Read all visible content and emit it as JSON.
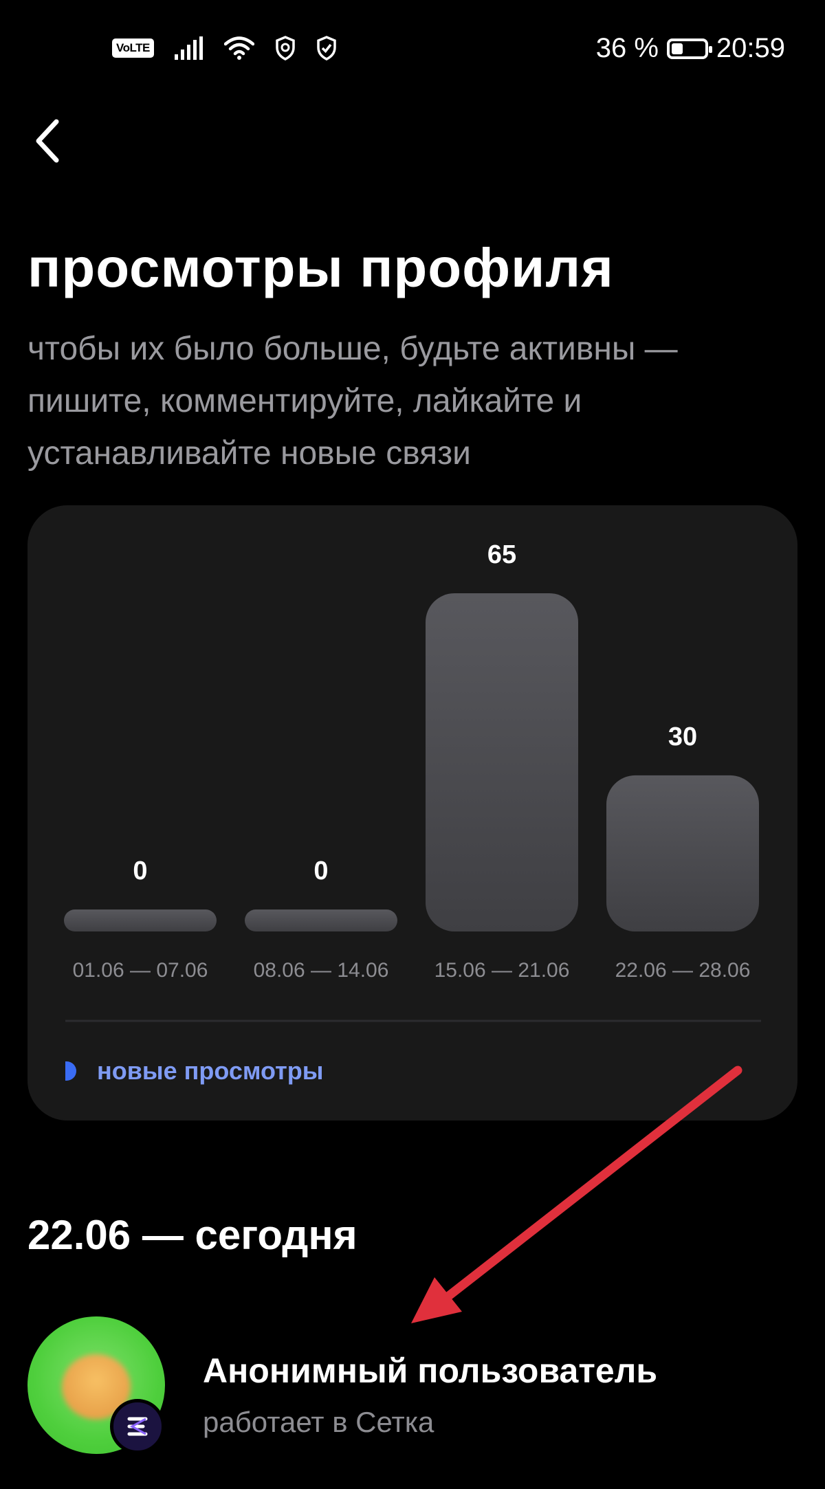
{
  "status_bar": {
    "volte": "VoLTE",
    "battery_percent": "36 %",
    "battery_level": 0.36,
    "time": "20:59",
    "icons": [
      "signal-icon",
      "wifi-icon",
      "shield-icon",
      "shield-check-icon"
    ]
  },
  "header": {
    "back_icon": "chevron-left-icon",
    "title": "просмотры профиля",
    "subtitle": "чтобы их было больше, будьте активны — пишите, комментируйте, лайкайте и устанавливайте новые связи"
  },
  "chart_data": {
    "type": "bar",
    "categories": [
      "01.06 — 07.06",
      "08.06 — 14.06",
      "15.06 — 21.06",
      "22.06 — 28.06"
    ],
    "series": [
      {
        "name": "новые просмотры",
        "values": [
          0,
          0,
          65,
          30
        ]
      }
    ],
    "value_labels": [
      "0",
      "0",
      "65",
      "30"
    ],
    "legend": {
      "label": "новые просмотры",
      "placement": "bottom-left",
      "color": "#3a6cf4"
    },
    "ylim": [
      0,
      65
    ],
    "grid": false
  },
  "section": {
    "title": "22.06 — сегодня"
  },
  "user": {
    "name": "Анонимный пользователь",
    "workplace": "работает в Сетка",
    "badge_icon": "setka-logo-icon"
  },
  "colors": {
    "background": "#000000",
    "card": "#191919",
    "bar": "#505055",
    "accent": "#3a6cf4",
    "arrow": "#e0303c"
  }
}
